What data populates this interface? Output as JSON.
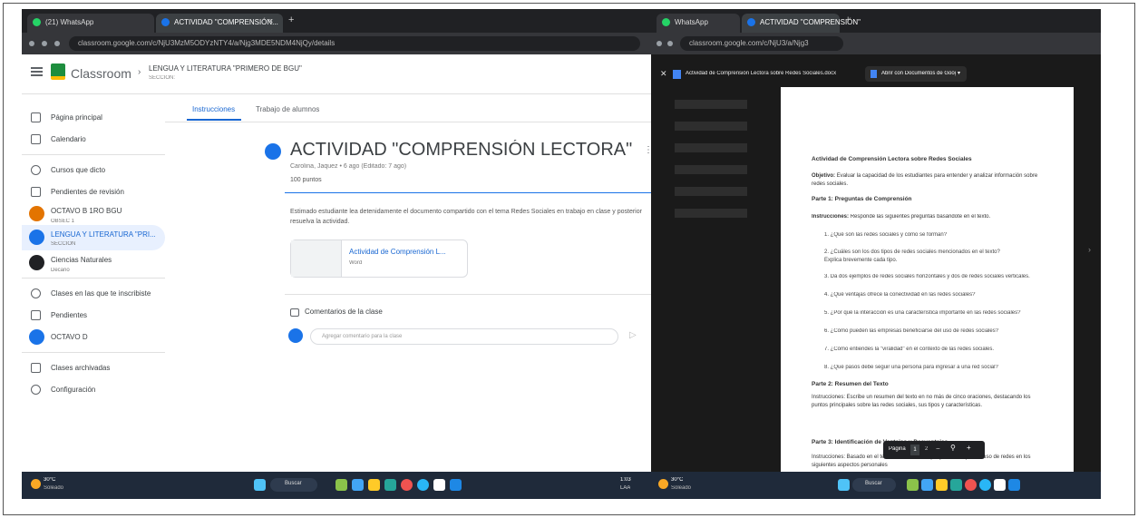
{
  "left": {
    "tabs": [
      {
        "label": "(21) WhatsApp",
        "active": false,
        "color": "#25d366"
      },
      {
        "label": "ACTIVIDAD \"COMPRENSIÓN...",
        "active": true,
        "color": "#1a73e8"
      }
    ],
    "url": "classroom.google.com/c/NjU3MzM5ODYzNTY4/a/Njg3MDE5NDM4NjQy/details",
    "header": {
      "brand": "Classroom",
      "breadcrumb_course": "LENGUA Y LITERATURA \"PRIMERO DE BGU\"",
      "breadcrumb_section": "SECCIÓN: "
    },
    "sidebar": {
      "items": [
        {
          "label": "Página principal",
          "sub": "",
          "avatar_color": ""
        },
        {
          "label": "Calendario",
          "sub": "",
          "avatar_color": ""
        },
        {
          "label": "Cursos que dicto",
          "sub": "",
          "avatar_color": ""
        },
        {
          "label": "Pendientes de revisión",
          "sub": "",
          "avatar_color": ""
        },
        {
          "label": "OCTAVO B 1RO BGU",
          "sub": "OBSEC 1",
          "avatar_color": "#e37400"
        },
        {
          "label": "LENGUA Y LITERATURA \"PRI...",
          "sub": "SECCIÓN",
          "avatar_color": "#1a73e8"
        },
        {
          "label": "Ciencias Naturales",
          "sub": "Decano",
          "avatar_color": "#202124"
        },
        {
          "label": "Clases en las que te inscribiste",
          "sub": "",
          "avatar_color": ""
        },
        {
          "label": "Pendientes",
          "sub": "",
          "avatar_color": ""
        },
        {
          "label": "OCTAVO D",
          "sub": "",
          "avatar_color": "#1a73e8"
        },
        {
          "label": "Clases archivadas",
          "sub": "",
          "avatar_color": ""
        },
        {
          "label": "Configuración",
          "sub": "",
          "avatar_color": ""
        }
      ]
    },
    "main": {
      "tabs": [
        "Instrucciones",
        "Trabajo de alumnos"
      ],
      "title": "ACTIVIDAD \"COMPRENSIÓN LECTORA\"",
      "meta": "Carolina, Jaquez • 6 ago (Editado: 7 ago)",
      "points": "100 puntos",
      "instructions": "Estimado estudiante lea detenidamente el documento compartido con el tema Redes Sociales en trabajo en clase y posterior resuelva la actividad.",
      "attachment_title": "Actividad de Comprensión L...",
      "attachment_type": "Word",
      "comments_label": "Comentarios de la clase",
      "comment_placeholder": "Agregar comentario para la clase"
    },
    "taskbar": {
      "weather": "30°C",
      "weather_sub": "Soleado",
      "search": "Buscar",
      "time": "1:03",
      "date": "LAA"
    }
  },
  "right": {
    "tabs": [
      {
        "label": "WhatsApp",
        "active": false,
        "color": "#25d366"
      },
      {
        "label": "ACTIVIDAD \"COMPRENSIÓN\"",
        "active": true,
        "color": "#1a73e8"
      }
    ],
    "url": "classroom.google.com/c/NjU3/a/Njg3",
    "viewer_title": "Actividad de Comprensión Lectora sobre Redes Sociales.docx",
    "open_with": "Abrir con Documentos de Google",
    "doc": {
      "title": "Actividad de Comprensión Lectora sobre Redes Sociales",
      "objective_label": "Objetivo:",
      "objective": "Evaluar la capacidad de los estudiantes para entender y analizar información sobre redes sociales.",
      "part1": "Parte 1: Preguntas de Comprensión",
      "instructions1_label": "Instrucciones:",
      "instructions1": "Responde las siguientes preguntas basándote en el texto.",
      "questions": [
        "1. ¿Qué son las redes sociales y cómo se forman?",
        "2. ¿Cuáles son los dos tipos de redes sociales mencionados en el texto? Explica brevemente cada tipo.",
        "3. Da dos ejemplos de redes sociales horizontales y dos de redes sociales verticales.",
        "4. ¿Qué ventajas ofrece la conectividad en las redes sociales?",
        "5. ¿Por qué la interacción es una característica importante en las redes sociales?",
        "6. ¿Cómo pueden las empresas beneficiarse del uso de redes sociales?",
        "7. ¿Cómo entiendes la \"viralidad\" en el contexto de las redes sociales.",
        "8. ¿Qué pasos debe seguir una persona para ingresar a una red social?"
      ],
      "part2": "Parte 2: Resumen del Texto",
      "instructions2": "Instrucciones: Escribe un resumen del texto en no más de cinco oraciones, destacando los puntos principales sobre las redes sociales, sus tipos y características.",
      "part3": "Parte 3: Identificación de Ventajas y Desventajas",
      "instructions3": "Instrucciones: Basado en el texto, identifica ventajas y desventajas del uso de redes en los siguientes aspectos personales"
    },
    "pager": {
      "label": "Página",
      "current": "1",
      "total": "2"
    },
    "taskbar": {
      "weather": "30°C",
      "weather_sub": "Soleado",
      "search": "Buscar"
    }
  }
}
